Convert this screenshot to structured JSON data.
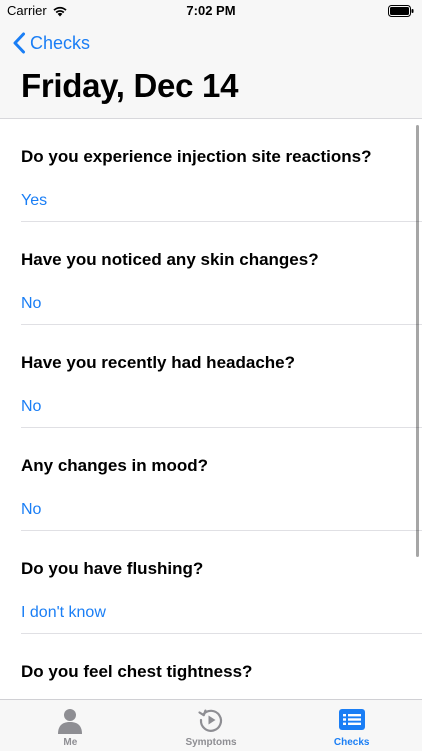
{
  "status_bar": {
    "carrier": "Carrier",
    "time": "7:02 PM"
  },
  "nav": {
    "back_label": "Checks",
    "title": "Friday, Dec 14"
  },
  "checks": [
    {
      "question": "Do you experience injection site reactions?",
      "answer": "Yes"
    },
    {
      "question": "Have you noticed any skin changes?",
      "answer": "No"
    },
    {
      "question": "Have you recently had headache?",
      "answer": "No"
    },
    {
      "question": "Any changes in mood?",
      "answer": "No"
    },
    {
      "question": "Do you have flushing?",
      "answer": "I don't know"
    },
    {
      "question": "Do you feel chest tightness?",
      "answer": ""
    }
  ],
  "tabs": [
    {
      "label": "Me",
      "icon": "person-icon",
      "active": false
    },
    {
      "label": "Symptoms",
      "icon": "symptoms-history-icon",
      "active": false
    },
    {
      "label": "Checks",
      "icon": "checklist-icon",
      "active": true
    }
  ],
  "colors": {
    "accent": "#1a7ef5",
    "inactive_tab": "#8e8e93",
    "header_bg": "#f7f7f7"
  }
}
